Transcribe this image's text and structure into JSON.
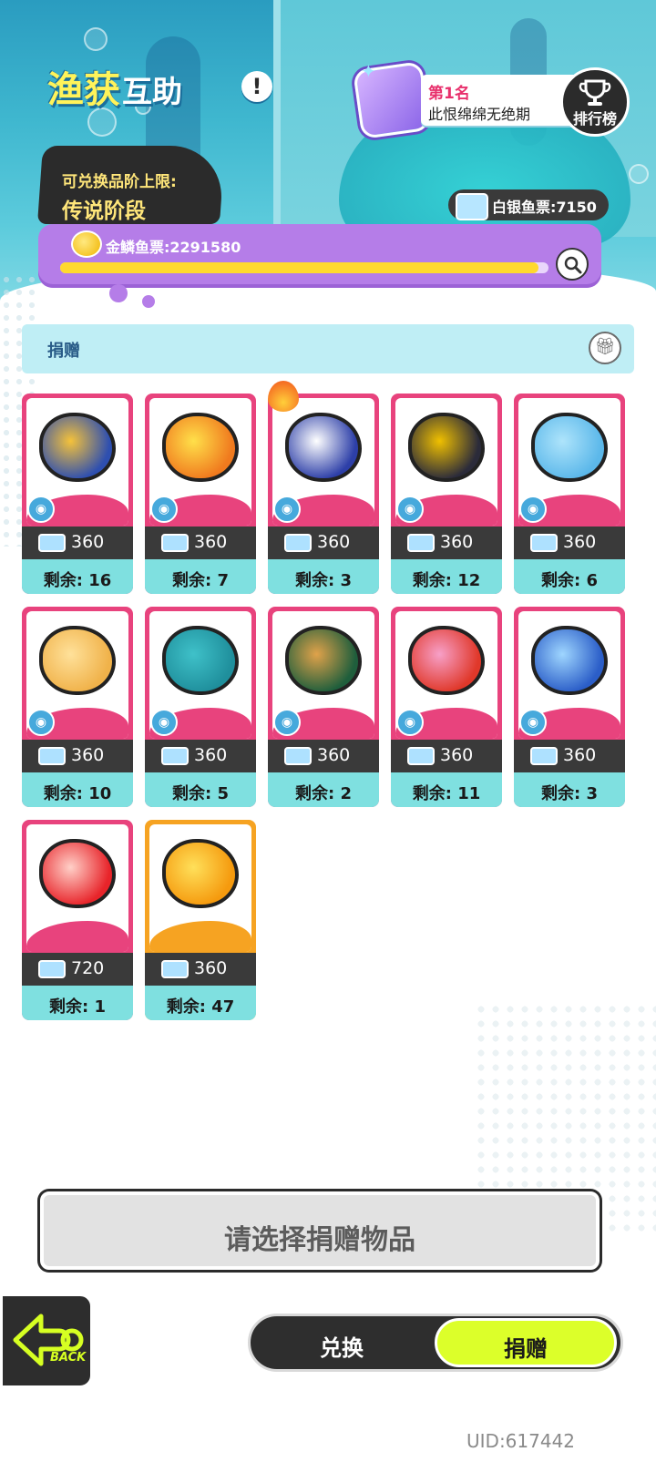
{
  "header": {
    "title_part1": "渔获",
    "title_part2": "互助",
    "info_icon": "exclamation-icon",
    "tier_label": "可兑换品阶上限:",
    "tier_value": "传说阶段"
  },
  "leaderboard": {
    "place": "第1名",
    "player_name": "此恨绵绵无绝期",
    "button_label": "排行榜",
    "icon": "trophy-icon"
  },
  "currency": {
    "silver_label": "白银鱼票:7150",
    "gold_label": "金鳞鱼票:2291580",
    "gold_progress": 0.98
  },
  "section": {
    "title": "捐赠",
    "icon": "gift-icon"
  },
  "items": [
    {
      "price": "360",
      "remain": "剩余: 16",
      "art": "blue-star-fish",
      "category_icon": "fish-icon",
      "hot": false,
      "rarity": "pink"
    },
    {
      "price": "360",
      "remain": "剩余: 7",
      "art": "orange-spotted-fish",
      "category_icon": "fish-icon",
      "hot": false,
      "rarity": "pink"
    },
    {
      "price": "360",
      "remain": "剩余: 3",
      "art": "chef-penguin-fish",
      "category_icon": "swirl-icon",
      "hot": true,
      "rarity": "pink"
    },
    {
      "price": "360",
      "remain": "剩余: 12",
      "art": "diver-creature",
      "category_icon": "swirl-icon",
      "hot": false,
      "rarity": "pink"
    },
    {
      "price": "360",
      "remain": "剩余: 6",
      "art": "blue-coral",
      "category_icon": "shell-icon",
      "hot": false,
      "rarity": "pink"
    },
    {
      "price": "360",
      "remain": "剩余: 10",
      "art": "golden-fossil-fish",
      "category_icon": "shell-icon",
      "hot": false,
      "rarity": "pink"
    },
    {
      "price": "360",
      "remain": "剩余: 5",
      "art": "teal-whale",
      "category_icon": "drop-icon",
      "hot": false,
      "rarity": "pink"
    },
    {
      "price": "360",
      "remain": "剩余: 2",
      "art": "green-cone-creature",
      "category_icon": "drop-icon",
      "hot": false,
      "rarity": "pink"
    },
    {
      "price": "360",
      "remain": "剩余: 11",
      "art": "red-octopus",
      "category_icon": "wave-icon",
      "hot": false,
      "rarity": "pink"
    },
    {
      "price": "360",
      "remain": "剩余: 3",
      "art": "flying-blue-fish",
      "category_icon": "wave-icon",
      "hot": false,
      "rarity": "pink"
    },
    {
      "price": "720",
      "remain": "剩余: 1",
      "art": "red-orb",
      "category_icon": "",
      "hot": false,
      "rarity": "pink"
    },
    {
      "price": "360",
      "remain": "剩余: 47",
      "art": "golden-flame-fish",
      "category_icon": "",
      "hot": false,
      "rarity": "gold"
    }
  ],
  "footer": {
    "select_prompt": "请选择捐赠物品",
    "back_label": "BACK",
    "tab_exchange": "兑换",
    "tab_donate": "捐赠",
    "uid": "UID:617442"
  },
  "colors": {
    "card_pink": "#e8437d",
    "card_gold": "#f6a322",
    "remain_bg": "#7fe0e0",
    "active_tab": "#dcff2a",
    "gold_bar": "#b57de8"
  }
}
